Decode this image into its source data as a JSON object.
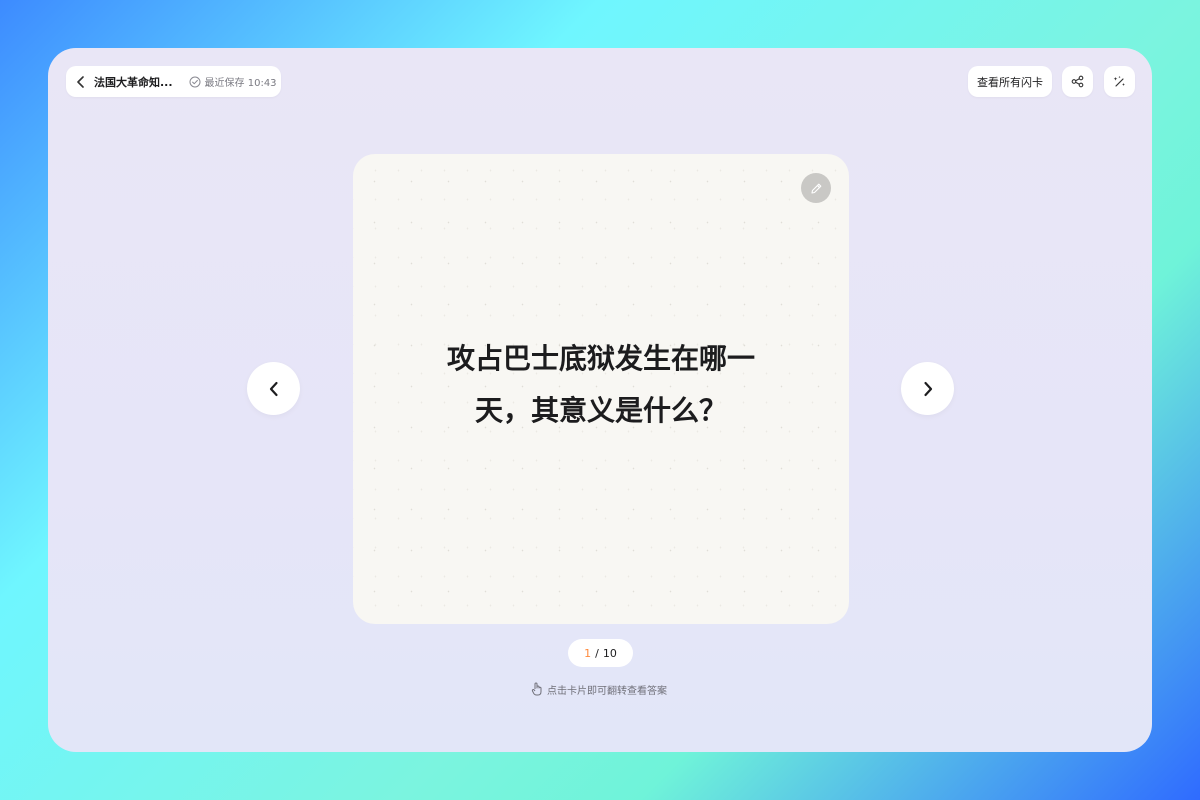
{
  "header": {
    "title": "法国大革命知...",
    "save_status": "最近保存 10:43",
    "view_all_label": "查看所有闪卡"
  },
  "icons": {
    "back": "chevron-left-icon",
    "save": "check-circle-icon",
    "share": "share-icon",
    "magic": "magic-wand-icon",
    "edit": "pencil-icon",
    "prev": "chevron-left-icon",
    "next": "chevron-right-icon",
    "hint": "hand-pointer-icon"
  },
  "card": {
    "question_line1": "攻占巴士底狱发生在哪一",
    "question_line2": "天，其意义是什么？"
  },
  "pagination": {
    "current": "1",
    "separator": "/",
    "total": "10"
  },
  "hint": {
    "text": "点击卡片即可翻转查看答案"
  },
  "colors": {
    "counter_current": "#ff8a3d",
    "card_background": "#f8f7f3",
    "frame_background": "#e8e6f7"
  }
}
